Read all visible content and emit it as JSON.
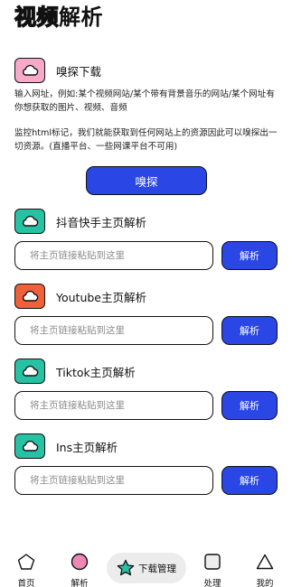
{
  "header": {
    "title_outline": "视频",
    "title_solid": "解析"
  },
  "sniff": {
    "title": "嗅探下载",
    "icon": "cloud-icon",
    "icon_color": "#f7a9c8",
    "desc1": "输入网址，例如:某个视频网站/某个带有背景音乐的网站/某个网址有你想获取的图片、视频、音频",
    "desc2": "监控html标记，我们就能获取到任何网站上的资源因此可以嗅探出一切资源。(直播平台、一些网课平台不可用)",
    "button": "嗅探"
  },
  "parsers": [
    {
      "title": "抖音快手主页解析",
      "icon_color": "#27c2a4",
      "placeholder": "将主页链接粘贴到这里",
      "button": "解析"
    },
    {
      "title": "Youtube主页解析",
      "icon_color": "#f0613b",
      "placeholder": "将主页链接粘贴到这里",
      "button": "解析"
    },
    {
      "title": "Tiktok主页解析",
      "icon_color": "#27c2a4",
      "placeholder": "将主页链接粘贴到这里",
      "button": "解析"
    },
    {
      "title": "Ins主页解析",
      "icon_color": "#27c2a4",
      "placeholder": "将主页链接粘贴到这里",
      "button": "解析"
    }
  ],
  "nav": {
    "home": "首页",
    "parse": "解析",
    "download": "下载管理",
    "process": "处理",
    "mine": "我的"
  },
  "colors": {
    "accent": "#2a46e4",
    "parse_dot": "#ee87b3",
    "star": "#27c2a4"
  }
}
